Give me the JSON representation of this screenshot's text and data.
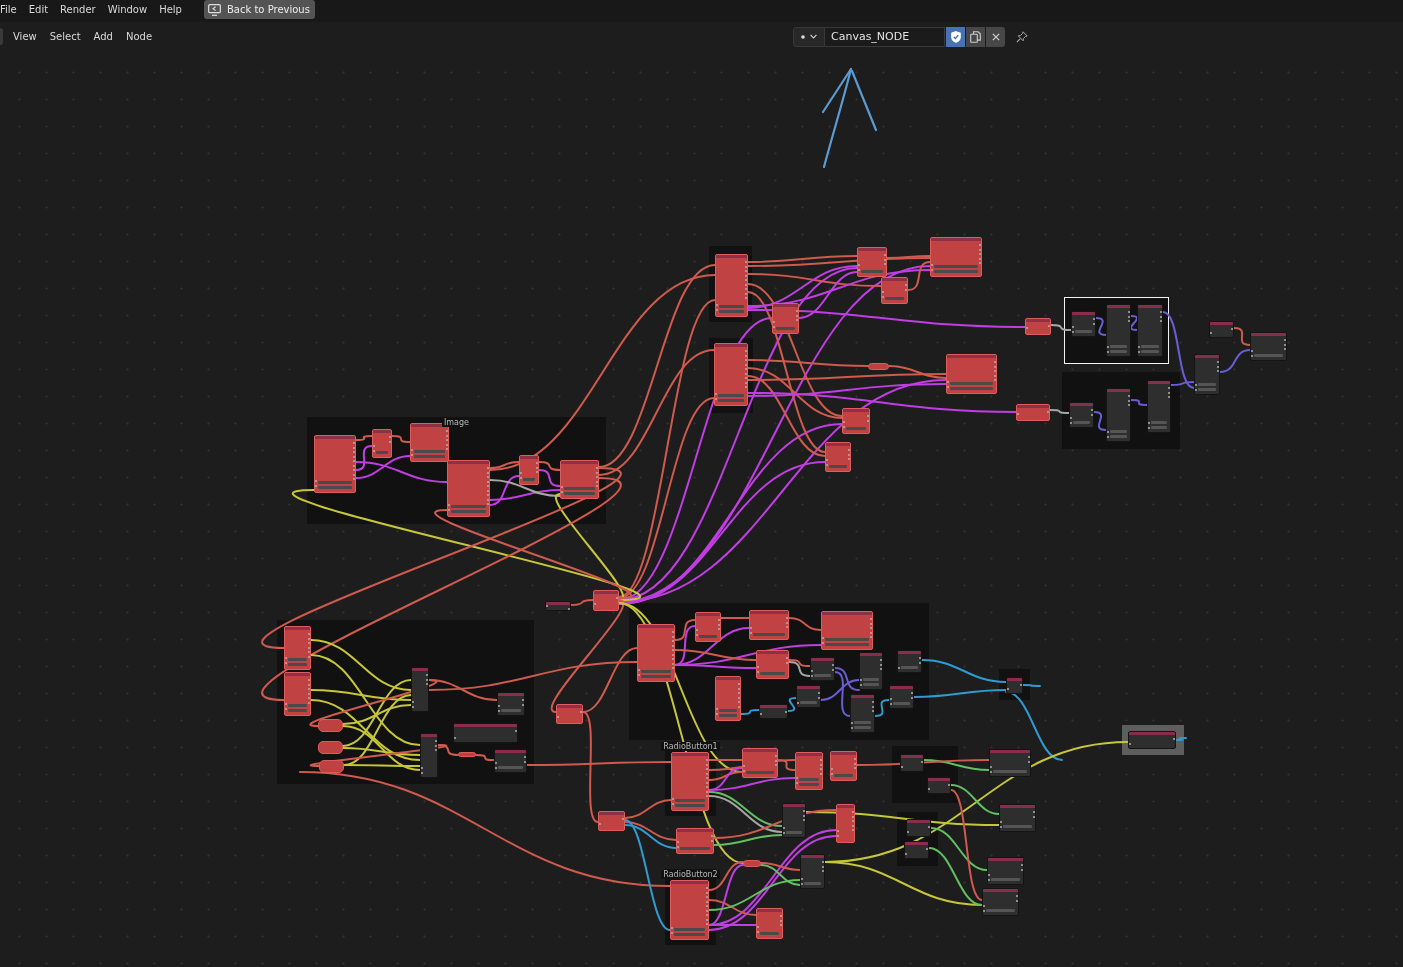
{
  "menu_bar": {
    "menus": [
      "File",
      "Edit",
      "Render",
      "Window",
      "Help"
    ],
    "back_button": "Back to Previous"
  },
  "header": {
    "menus": [
      "View",
      "Select",
      "Add",
      "Node"
    ],
    "datablock": {
      "name": "Canvas_NODE",
      "fake_user": true
    }
  },
  "node_editor": {
    "frames": [
      {
        "selected": false,
        "color": "#111111"
      },
      {
        "selected": true,
        "color": "#111111"
      },
      {
        "selected": false,
        "color": "#111111"
      },
      {
        "selected": false,
        "color": "#111111"
      },
      {
        "label": "Image",
        "selected": false,
        "color": "#111111"
      },
      {
        "selected": false,
        "color": "#111111"
      },
      {
        "selected": false,
        "color": "#111111"
      },
      {
        "selected": false,
        "color": "#111111"
      },
      {
        "selected": false,
        "color": "#5e5e5e"
      },
      {
        "label": "RadioButton1",
        "selected": false,
        "color": "#111111"
      },
      {
        "selected": false,
        "color": "#111111"
      },
      {
        "selected": false,
        "color": "#111111"
      },
      {
        "label": "RadioButton2",
        "selected": false,
        "color": "#111111"
      }
    ]
  }
}
